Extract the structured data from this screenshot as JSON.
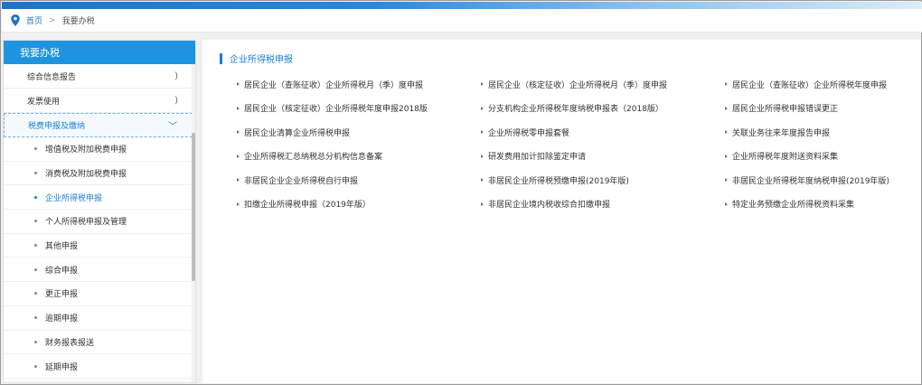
{
  "breadcrumb": {
    "home": "首页",
    "separator": ">",
    "current": "我要办税"
  },
  "sidebar": {
    "title": "我要办税",
    "items": [
      {
        "label": "综合信息报告",
        "chevron": ")"
      },
      {
        "label": "发票使用",
        "chevron": ")"
      },
      {
        "label": "税费申报及缴纳",
        "chevron": "﹀"
      }
    ],
    "subitems": [
      "增值税及附加税费申报",
      "消费税及附加税费申报",
      "企业所得税申报",
      "个人所得税申报及管理",
      "其他申报",
      "综合申报",
      "更正申报",
      "逾期申报",
      "财务报表报送",
      "延期申报"
    ],
    "active_subitem_index": 2
  },
  "main": {
    "section_title": "企业所得税申报",
    "links": [
      "居民企业（查账征收）企业所得税月（季）度申报",
      "居民企业（核定征收）企业所得税月（季）度申报",
      "居民企业（查账征收）企业所得税年度申报",
      "居民企业（核定征收）企业所得税年度申报2018版",
      "分支机构企业所得税年度纳税申报表（2018版）",
      "居民企业所得税申报错误更正",
      "居民企业清算企业所得税申报",
      "企业所得税零申报套餐",
      "关联业务往来年度报告申报",
      "企业所得税汇总纳税总分机构信息备案",
      "研发费用加计扣除鉴定申请",
      "企业所得税年度附送资料采集",
      "非居民企业企业所得税自行申报",
      "非居民企业所得税预缴申报(2019年版)",
      "非居民企业所得税年度纳税申报(2019年版)",
      "扣缴企业所得税申报（2019年版）",
      " 非居民企业境内税收综合扣缴申报",
      "特定业务预缴企业所得税资料采集"
    ]
  },
  "colors": {
    "accent": "#1a7fd6",
    "sidebar_header": "#1e94e0",
    "topbar": "#2a86dc"
  },
  "icons": {
    "location": "location-pin-icon"
  }
}
